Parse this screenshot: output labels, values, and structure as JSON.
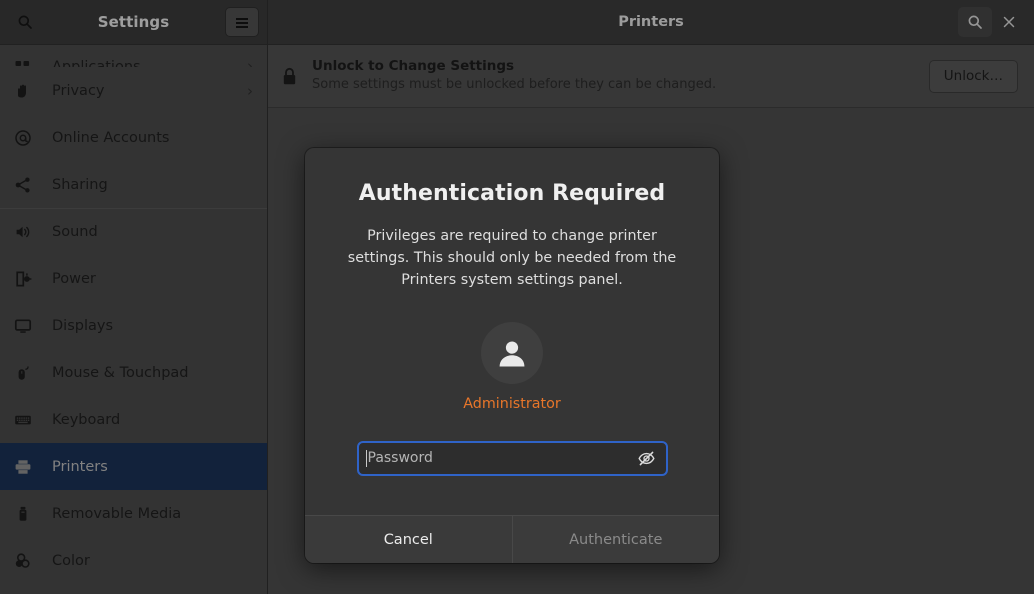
{
  "window": {
    "sidebar_title": "Settings",
    "main_title": "Printers"
  },
  "sidebar": {
    "search_icon": "search-icon",
    "menu_icon": "hamburger-menu-icon",
    "items": [
      {
        "label": "Applications",
        "icon": "applications-grid-icon",
        "chevron": "›",
        "clipped": true,
        "selected": false,
        "separator": false
      },
      {
        "label": "Privacy",
        "icon": "hand-icon",
        "chevron": "›",
        "clipped": false,
        "selected": false,
        "separator": false
      },
      {
        "label": "Online Accounts",
        "icon": "at-sign-icon",
        "chevron": "",
        "clipped": false,
        "selected": false,
        "separator": false
      },
      {
        "label": "Sharing",
        "icon": "share-nodes-icon",
        "chevron": "",
        "clipped": false,
        "selected": false,
        "separator": false
      },
      {
        "label": "Sound",
        "icon": "speaker-icon",
        "chevron": "",
        "clipped": false,
        "selected": false,
        "separator": true
      },
      {
        "label": "Power",
        "icon": "power-plug-icon",
        "chevron": "",
        "clipped": false,
        "selected": false,
        "separator": false
      },
      {
        "label": "Displays",
        "icon": "monitor-icon",
        "chevron": "",
        "clipped": false,
        "selected": false,
        "separator": false
      },
      {
        "label": "Mouse & Touchpad",
        "icon": "mouse-icon",
        "chevron": "",
        "clipped": false,
        "selected": false,
        "separator": false
      },
      {
        "label": "Keyboard",
        "icon": "keyboard-icon",
        "chevron": "",
        "clipped": false,
        "selected": false,
        "separator": false
      },
      {
        "label": "Printers",
        "icon": "printer-icon",
        "chevron": "",
        "clipped": false,
        "selected": true,
        "separator": false
      },
      {
        "label": "Removable Media",
        "icon": "usb-drive-icon",
        "chevron": "",
        "clipped": false,
        "selected": false,
        "separator": false
      },
      {
        "label": "Color",
        "icon": "color-circles-icon",
        "chevron": "",
        "clipped": false,
        "selected": false,
        "separator": false
      }
    ]
  },
  "main_header": {
    "search_icon": "search-icon",
    "close_icon": "close-icon"
  },
  "banner": {
    "lock_icon": "padlock-icon",
    "title": "Unlock to Change Settings",
    "subtitle": "Some settings must be unlocked before they can be changed.",
    "unlock_label": "Unlock…"
  },
  "dialog": {
    "title": "Authentication Required",
    "description": "Privileges are required to change printer settings. This should only be needed from the Printers system settings panel.",
    "avatar_icon": "user-avatar-icon",
    "username": "Administrator",
    "password_placeholder": "Password",
    "password_value": "",
    "reveal_icon": "eye-slash-icon",
    "cancel_label": "Cancel",
    "authenticate_label": "Authenticate",
    "authenticate_disabled": true
  },
  "colors": {
    "sidebar_bg": "#4a4a4a",
    "content_bg": "#4c4c4c",
    "header_bg": "#3b3b3b",
    "dialog_bg": "#353535",
    "selection_blue": "#1b3255",
    "focus_blue": "#2f63c8",
    "username_orange": "#e8762a"
  }
}
